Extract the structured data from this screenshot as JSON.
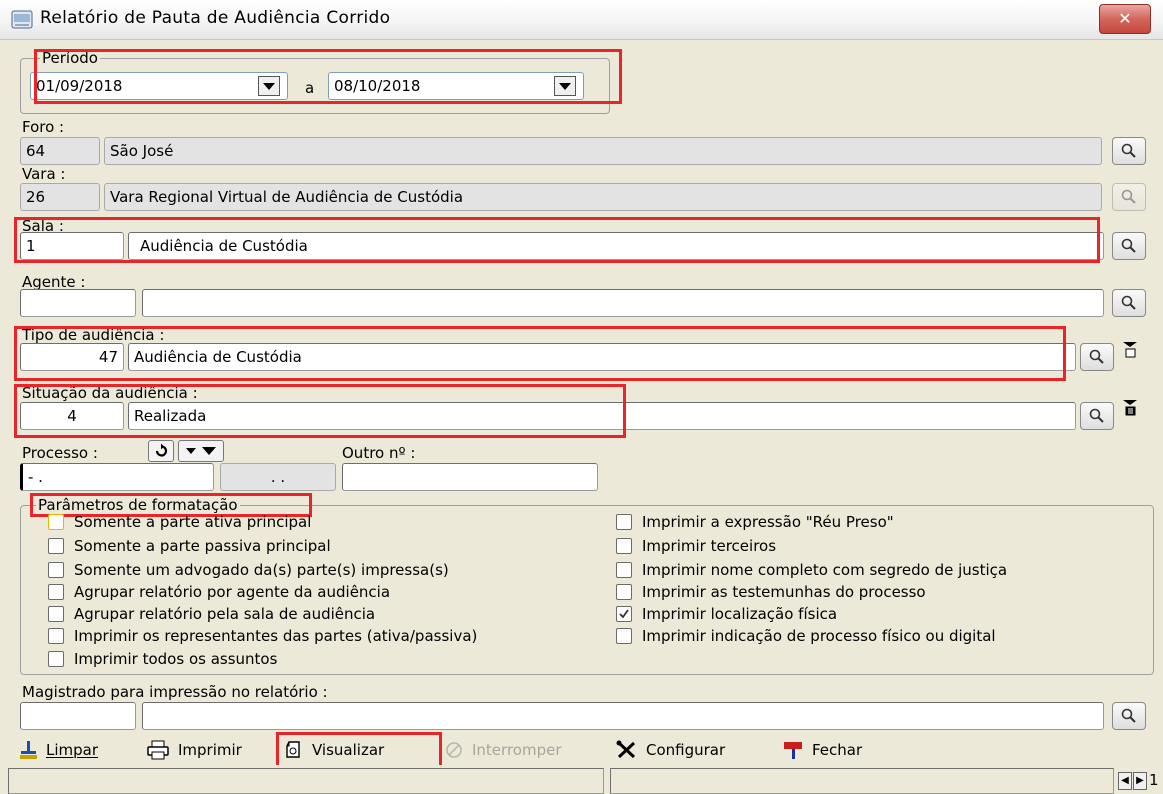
{
  "window": {
    "title": "Relatório de Pauta de Audiência Corrido",
    "close_label": "✕"
  },
  "periodo": {
    "label": "Período",
    "from": "01/09/2018",
    "separator": "a",
    "to": "08/10/2018"
  },
  "foro": {
    "label": "Foro :",
    "code": "64",
    "name": "São José"
  },
  "vara": {
    "label": "Vara :",
    "code": "26",
    "name": "Vara Regional Virtual de Audiência  de Custódia"
  },
  "sala": {
    "label": "Sala :",
    "code": "1",
    "name": "Audiência  de Custódia"
  },
  "agente": {
    "label": "Agente :",
    "code": "",
    "name": ""
  },
  "tipo": {
    "label": "Tipo de audiência :",
    "code": "47",
    "name": "Audiência de Custódia"
  },
  "situacao": {
    "label": "Situação da audiência :",
    "code": "4",
    "name": "Realizada"
  },
  "processo": {
    "label": "Processo :",
    "value": "- .",
    "value2": ". .",
    "outro_label": "Outro nº :",
    "outro_value": ""
  },
  "parametros": {
    "label": "Parâmetros de formatação",
    "left": [
      {
        "label": "Somente a parte ativa principal",
        "checked": false
      },
      {
        "label": "Somente a parte passiva principal",
        "checked": false
      },
      {
        "label": "Somente um advogado da(s) parte(s) impressa(s)",
        "checked": false
      },
      {
        "label": "Agrupar relatório por agente da audiência",
        "checked": false
      },
      {
        "label": "Agrupar relatório pela sala de audiência",
        "checked": false
      },
      {
        "label": "Imprimir os representantes das partes (ativa/passiva)",
        "checked": false
      },
      {
        "label": "Imprimir todos os assuntos",
        "checked": false
      }
    ],
    "right": [
      {
        "label": "Imprimir a expressão \"Réu Preso\"",
        "checked": false
      },
      {
        "label": "Imprimir terceiros",
        "checked": false
      },
      {
        "label": "Imprimir nome completo com segredo de justiça",
        "checked": false
      },
      {
        "label": "Imprimir as testemunhas do processo",
        "checked": false
      },
      {
        "label": "Imprimir localização física",
        "checked": true
      },
      {
        "label": "Imprimir indicação de processo físico ou digital",
        "checked": false
      }
    ]
  },
  "magistrado": {
    "label": "Magistrado para impressão no relatório :",
    "code": "",
    "name": ""
  },
  "toolbar": {
    "limpar": "Limpar",
    "imprimir": "Imprimir",
    "visualizar": "Visualizar",
    "interromper": "Interromper",
    "configurar": "Configurar",
    "fechar": "Fechar"
  },
  "statusbar": {
    "page": "1"
  },
  "colors": {
    "highlight": "#e8262a",
    "accent": "#7f9db9"
  }
}
